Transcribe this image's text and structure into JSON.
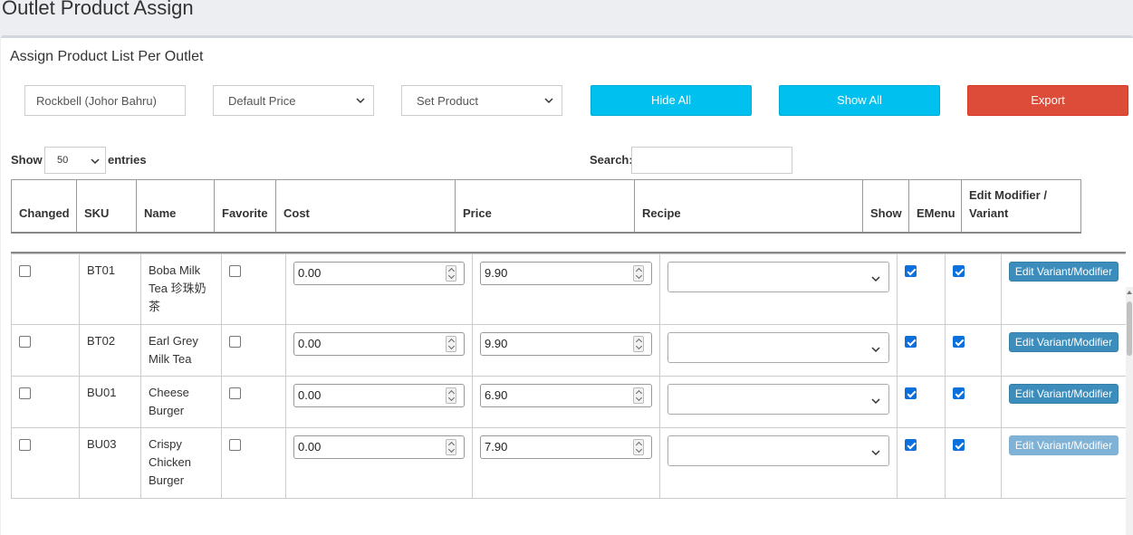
{
  "page": {
    "title": "Outlet Product Assign"
  },
  "panel": {
    "subtitle": "Assign Product List Per Outlet"
  },
  "filters": {
    "outlet": "Rockbell (Johor Bahru)",
    "price_type": "Default Price",
    "product_set": "Set Product"
  },
  "buttons": {
    "hide_all": "Hide All",
    "show_all": "Show All",
    "export": "Export"
  },
  "table_controls": {
    "show_label": "Show",
    "entries_value": "50",
    "entries_label": "entries",
    "search_label": "Search:"
  },
  "columns": [
    "Changed",
    "SKU",
    "Name",
    "Favorite",
    "Cost",
    "Price",
    "Recipe",
    "Show",
    "EMenu",
    "Edit Modifier / Variant"
  ],
  "rows": [
    {
      "changed": false,
      "sku": "BT01",
      "name": "Boba Milk Tea 珍珠奶茶",
      "favorite": false,
      "cost": "0.00",
      "price": "9.90",
      "recipe": "",
      "show": true,
      "emenu": true,
      "edit_label": "Edit Variant/Modifier",
      "edit_enabled": true
    },
    {
      "changed": false,
      "sku": "BT02",
      "name": "Earl Grey Milk Tea",
      "favorite": false,
      "cost": "0.00",
      "price": "9.90",
      "recipe": "",
      "show": true,
      "emenu": true,
      "edit_label": "Edit Variant/Modifier",
      "edit_enabled": true
    },
    {
      "changed": false,
      "sku": "BU01",
      "name": "Cheese Burger",
      "favorite": false,
      "cost": "0.00",
      "price": "6.90",
      "recipe": "",
      "show": true,
      "emenu": true,
      "edit_label": "Edit Variant/Modifier",
      "edit_enabled": true
    },
    {
      "changed": false,
      "sku": "BU03",
      "name": "Crispy Chicken Burger",
      "favorite": false,
      "cost": "0.00",
      "price": "7.90",
      "recipe": "",
      "show": true,
      "emenu": true,
      "edit_label": "Edit Variant/Modifier",
      "edit_enabled": false
    }
  ],
  "icons": {
    "select_chevron": "chevron-down-icon",
    "spinner": "number-spinner-icon",
    "scroll_up": "arrow-up-icon"
  }
}
